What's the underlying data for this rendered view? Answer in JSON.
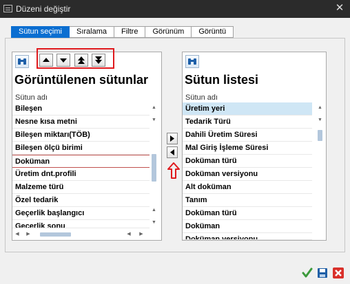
{
  "window": {
    "title": "Düzeni değiştir"
  },
  "tabs": [
    "Sütun seçimi",
    "Sıralama",
    "Filtre",
    "Görünüm",
    "Görüntü"
  ],
  "active_tab": 0,
  "left": {
    "title": "Görüntülenen sütunlar",
    "column_header": "Sütun adı",
    "rows": [
      "Bileşen",
      "Nesne kısa metni",
      "Bileşen miktarı(TÖB)",
      "Bileşen ölçü birimi",
      "Doküman",
      "Üretim dnt.profili",
      "Malzeme türü",
      "Özel tedarik",
      "Geçerlik başlangıcı",
      "Geçerlik sonu"
    ],
    "current_row": 4
  },
  "right": {
    "title": "Sütun listesi",
    "column_header": "Sütun adı",
    "rows": [
      "Üretim yeri",
      "Tedarik Türü",
      "Dahili Üretim Süresi",
      "Mal Giriş İşleme Süresi",
      "Doküman türü",
      "Doküman versiyonu",
      "Alt doküman",
      "Tanım",
      "Doküman türü",
      "Doküman",
      "Doküman versiyonu"
    ],
    "selected_row": 0
  },
  "icons": {
    "left_find": "binoculars-icon",
    "right_find": "binoculars-icon",
    "move_up": "triangle-up-icon",
    "move_down": "triangle-down-icon",
    "move_top": "double-triangle-up-icon",
    "move_bottom": "double-triangle-down-icon",
    "move_to_right": "triangle-right-icon",
    "move_to_left": "triangle-left-icon",
    "hint_arrow": "up-arrow-outline-icon",
    "ok": "checkmark-icon",
    "save": "floppy-disk-icon",
    "cancel": "red-x-icon"
  },
  "colors": {
    "titlebar": "#2b2b2b",
    "active_tab": "#0a6ed1",
    "selected_row": "#cfe6f5",
    "highlight_red": "#e0191d",
    "ok_green": "#3c9a3c",
    "cancel_red": "#d9302a"
  }
}
